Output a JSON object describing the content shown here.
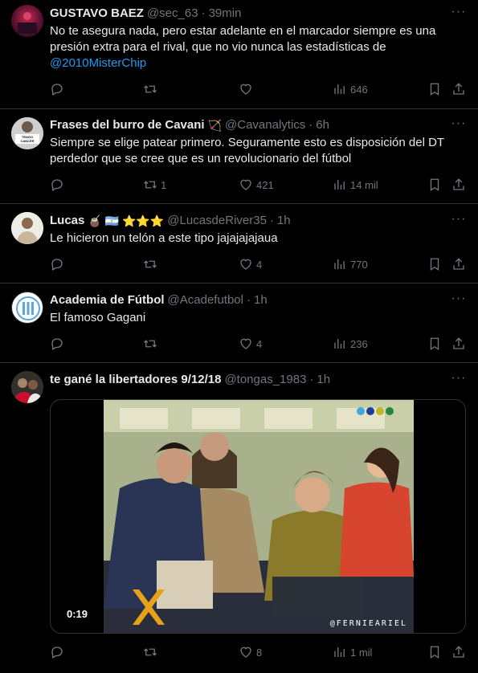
{
  "tweets": [
    {
      "name": "GUSTAVO BAEZ",
      "handle": "@sec_63",
      "time": "39min",
      "text": "No te asegura nada, pero estar adelante en el marcador siempre es una presión extra para el rival, que no vio nunca las estadísticas de ",
      "mention": "@2010MisterChip",
      "retweets": "",
      "likes": "",
      "views": "646"
    },
    {
      "name": "Frases del burro de Cavani",
      "name_emoji": "🏹",
      "handle": "@Cavanalytics",
      "time": "6h",
      "avatar_text": "TENGO CANCER",
      "text": "Siempre se elige patear primero. Seguramente esto es disposición del DT perdedor que se cree que es un revolucionario del fútbol",
      "retweets": "1",
      "likes": "421",
      "views": "14 mil"
    },
    {
      "name": "Lucas",
      "name_emoji": "🧉 🇦🇷 ⭐⭐⭐",
      "handle": "@LucasdeRiver35",
      "time": "1h",
      "text": "Le hicieron un telón a este tipo jajajajajaua",
      "retweets": "",
      "likes": "4",
      "views": "770"
    },
    {
      "name": "Academia de Fútbol",
      "handle": "@Acadefutbol",
      "time": "1h",
      "text": "El famoso Gagani",
      "retweets": "",
      "likes": "4",
      "views": "236"
    },
    {
      "name": "te gané la libertadores 9/12/18",
      "handle": "@tongas_1983",
      "time": "1h",
      "video": {
        "duration": "0:19",
        "watermark": "@FERNIEARIEL"
      },
      "retweets": "",
      "likes": "8",
      "views": "1 mil"
    }
  ],
  "colors": {
    "background": "#000000",
    "text": "#e7e9ea",
    "muted": "#71767b",
    "link": "#1d9bf0",
    "divider": "#2f3336"
  },
  "icons": [
    "reply-icon",
    "retweet-icon",
    "like-icon",
    "views-icon",
    "bookmark-icon",
    "share-icon",
    "more-icon"
  ]
}
